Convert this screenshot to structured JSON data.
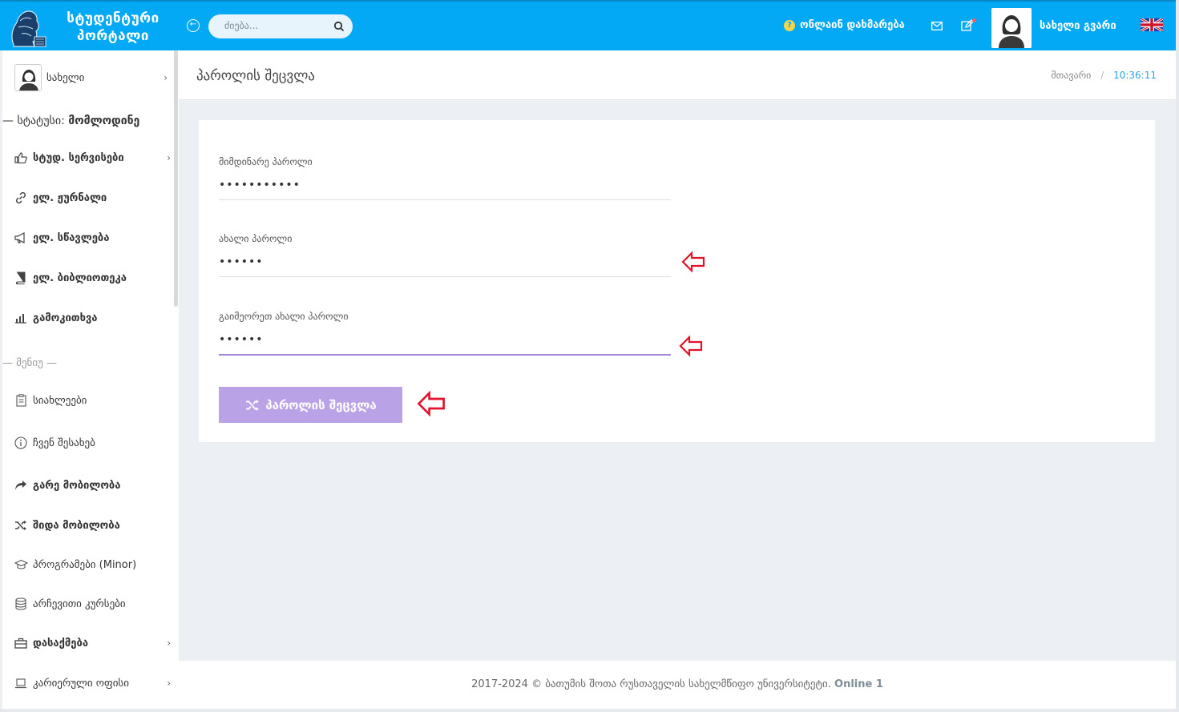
{
  "header": {
    "brand_line1": "სტუდენტური",
    "brand_line2": "პორტალი",
    "search_placeholder": "ძიება...",
    "help_label": "ონლაინ დახმარება",
    "user_name": "სახელი გვარი"
  },
  "sidebar": {
    "profile_name": "სახელი",
    "status_prefix": "— სტატუსი:",
    "status_value": "მომლოდინე",
    "section_menu": "— მენიუ —",
    "items": [
      {
        "label": "სტუდ. სერვისები",
        "icon": "thumbs-up-icon",
        "bold": true,
        "chevron": true
      },
      {
        "label": "ელ. ჟურნალი",
        "icon": "link-icon",
        "bold": true,
        "chevron": false
      },
      {
        "label": "ელ. სწავლება",
        "icon": "megaphone-icon",
        "bold": true,
        "chevron": false
      },
      {
        "label": "ელ. ბიბლიოთეკა",
        "icon": "book-icon",
        "bold": true,
        "chevron": false
      },
      {
        "label": "გამოკითხვა",
        "icon": "bar-chart-icon",
        "bold": true,
        "chevron": false
      },
      {
        "label": "სიახლეები",
        "icon": "clipboard-icon",
        "bold": false,
        "chevron": false
      },
      {
        "label": "ჩვენ შესახებ",
        "icon": "info-icon",
        "bold": false,
        "chevron": false
      },
      {
        "label": "გარე მობილობა",
        "icon": "share-icon",
        "bold": true,
        "chevron": false
      },
      {
        "label": "შიდა მობილობა",
        "icon": "shuffle-icon",
        "bold": true,
        "chevron": false
      },
      {
        "label": "პროგრამები (Minor)",
        "icon": "graduation-cap-icon",
        "bold": false,
        "chevron": false
      },
      {
        "label": "არჩევითი კურსები",
        "icon": "database-icon",
        "bold": false,
        "chevron": false
      },
      {
        "label": "დასაქმება",
        "icon": "briefcase-icon",
        "bold": true,
        "chevron": true
      },
      {
        "label": "კარიერული ოფისი",
        "icon": "laptop-icon",
        "bold": false,
        "chevron": true
      }
    ]
  },
  "page": {
    "title": "პაროლის შეცვლა",
    "breadcrumb_home": "მთავარი",
    "breadcrumb_sep": "/",
    "time": "10:36:11"
  },
  "form": {
    "current_label": "მიმდინარე პაროლი",
    "current_value": "•••••••••••",
    "new_label": "ახალი პაროლი",
    "new_value": "••••••",
    "repeat_label": "გაიმეორეთ ახალი პაროლი",
    "repeat_value": "••••••",
    "submit_label": "პაროლის შეცვლა"
  },
  "footer": {
    "text": "2017-2024 © ბათუმის შოთა რუსთაველის სახელმწიფო უნივერსიტეტი.",
    "online": "Online 1"
  },
  "colors": {
    "header": "#03a9f4",
    "button": "#b9a2e6",
    "arrow": "#e3122a",
    "time": "#2aa4e5"
  }
}
